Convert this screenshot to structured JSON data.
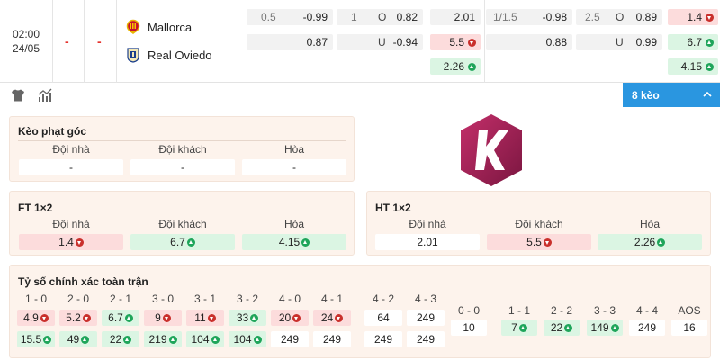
{
  "match": {
    "time": "02:00",
    "date": "24/05",
    "score_home": "-",
    "score_away": "-",
    "home_team": "Mallorca",
    "away_team": "Real Oviedo",
    "ah_ft": {
      "line": "0.5",
      "home": "-0.99",
      "away": "0.87"
    },
    "ou_ft": {
      "line": "1",
      "over_label": "O",
      "over": "0.82",
      "under_label": "U",
      "under": "-0.94"
    },
    "x12_ft": {
      "home": "2.01",
      "away": "5.5",
      "draw": "2.26"
    },
    "ah_ht": {
      "line": "1/1.5",
      "home": "-0.98",
      "away": "0.88"
    },
    "ou_ht": {
      "line": "2.5",
      "over_label": "O",
      "over": "0.89",
      "under_label": "U",
      "under": "0.99"
    },
    "x12_ht": {
      "home": "1.4",
      "away": "6.7",
      "draw": "4.15"
    }
  },
  "toolbar": {
    "more_label": "8 kèo"
  },
  "corner": {
    "title": "Kèo phạt góc",
    "headers": [
      "Đội nhà",
      "Đội khách",
      "Hòa"
    ],
    "values": [
      "-",
      "-",
      "-"
    ]
  },
  "ft12": {
    "title": "FT 1×2",
    "headers": [
      "Đội nhà",
      "Đội khách",
      "Hòa"
    ],
    "values": [
      "1.4",
      "6.7",
      "4.15"
    ]
  },
  "ht12": {
    "title": "HT 1×2",
    "headers": [
      "Đội nhà",
      "Đội khách",
      "Hòa"
    ],
    "values": [
      "2.01",
      "5.5",
      "2.26"
    ]
  },
  "correct_score": {
    "title": "Tỷ số chính xác toàn trận",
    "home_headers": [
      "1 - 0",
      "2 - 0",
      "2 - 1",
      "3 - 0",
      "3 - 1",
      "3 - 2",
      "4 - 0",
      "4 - 1",
      "4 - 2",
      "4 - 3"
    ],
    "home_row1": [
      "4.9",
      "5.2",
      "6.7",
      "9",
      "11",
      "33",
      "20",
      "24",
      "64",
      "249"
    ],
    "home_row2": [
      "15.5",
      "49",
      "22",
      "219",
      "104",
      "104",
      "249",
      "249",
      "249",
      "249"
    ],
    "draw_headers": [
      "0 - 0",
      "1 - 1",
      "2 - 2",
      "3 - 3",
      "4 - 4",
      "AOS"
    ],
    "draw_values": [
      "10",
      "7",
      "22",
      "149",
      "249",
      "16"
    ]
  },
  "colors": {
    "accent": "#2a96e0",
    "up": "#1fa55a",
    "down": "#c9302c",
    "panel": "#fdf3ec"
  }
}
